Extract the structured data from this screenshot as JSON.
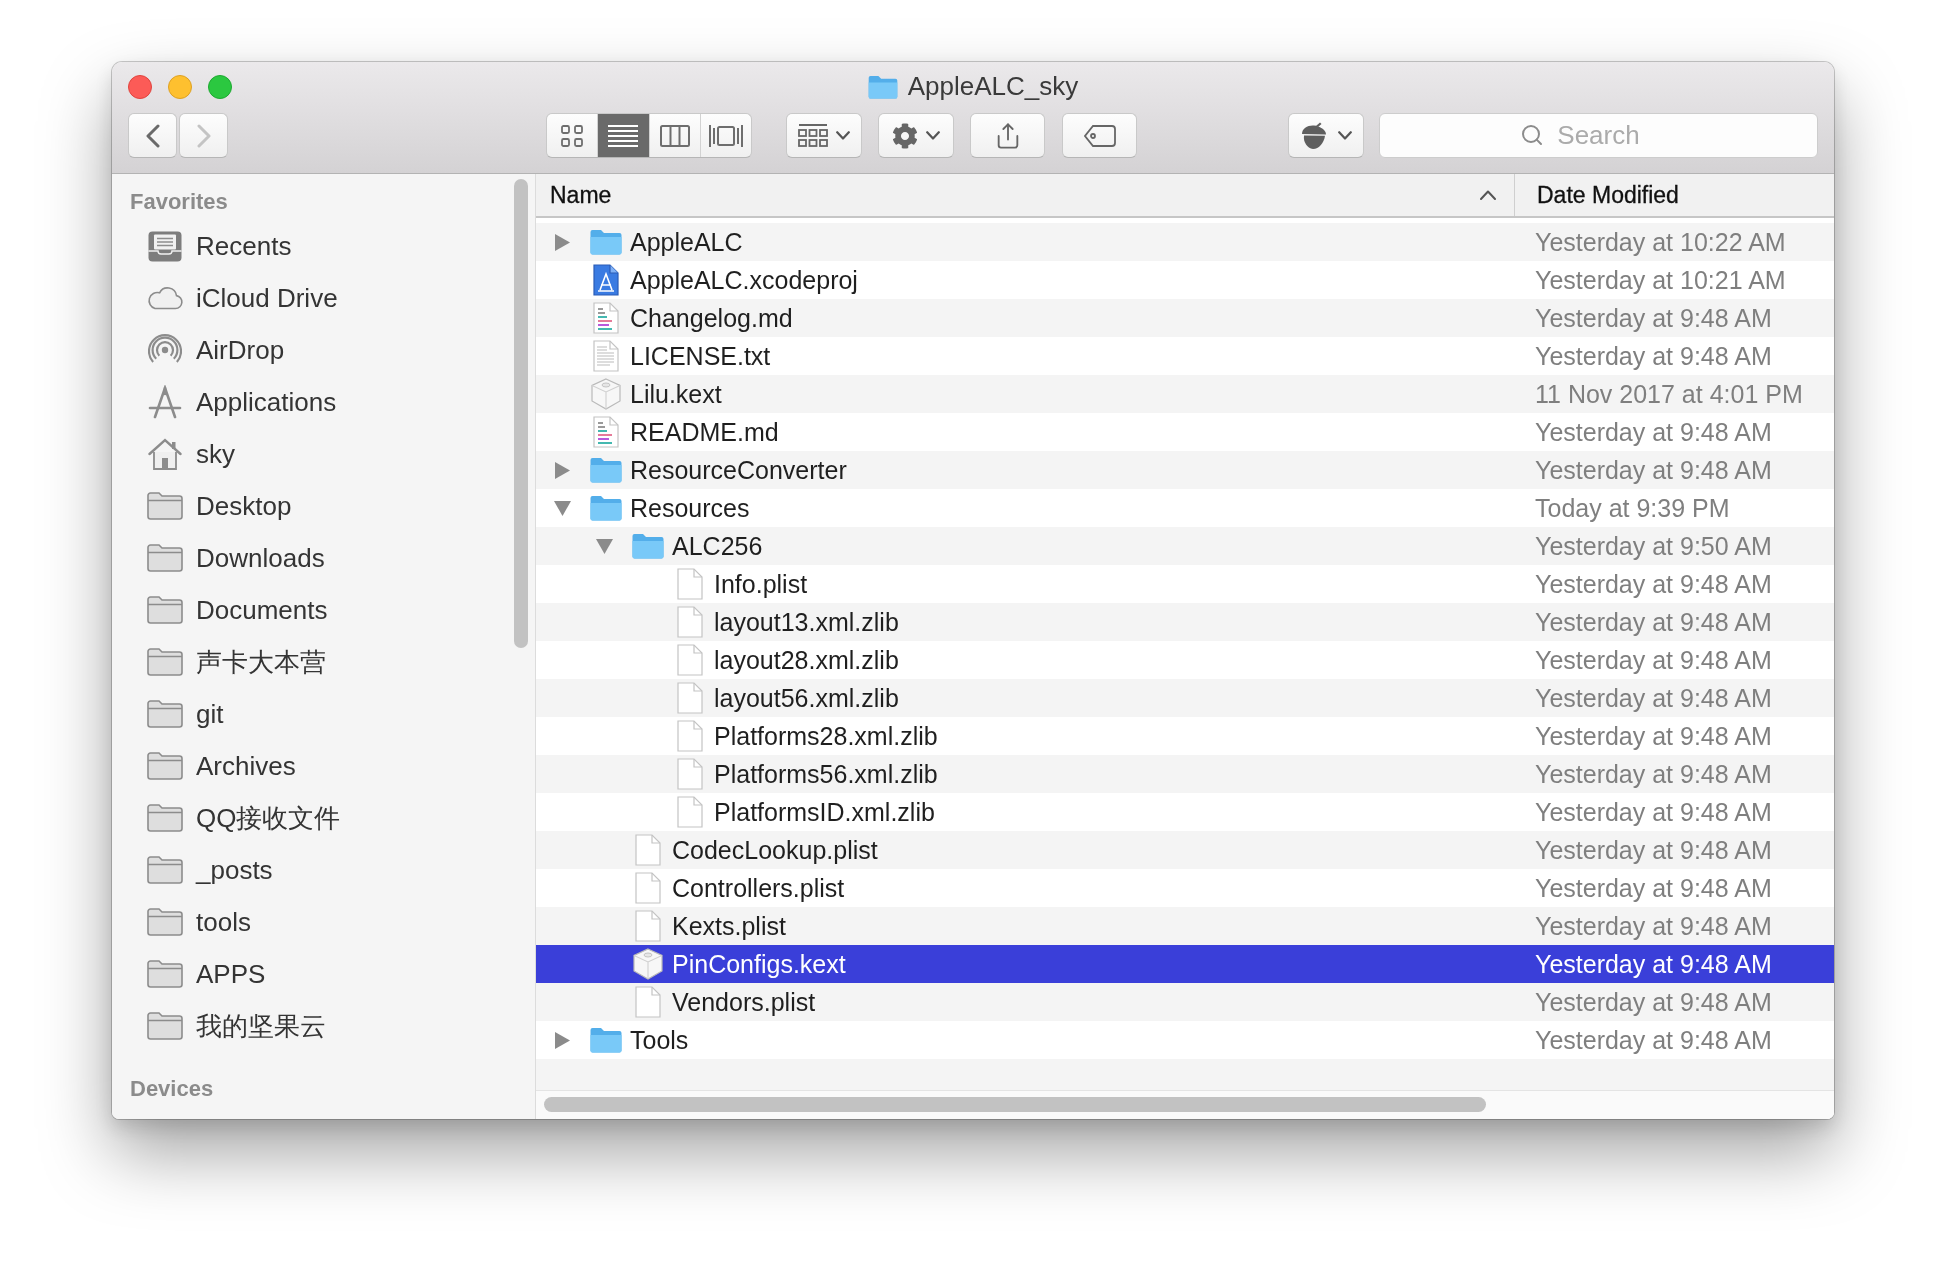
{
  "window": {
    "title": "AppleALC_sky"
  },
  "toolbar": {
    "navigation": [
      {
        "kind": "back",
        "disabled": false
      },
      {
        "kind": "forward",
        "disabled": true
      }
    ],
    "view_modes": [
      {
        "kind": "icons",
        "selected": false
      },
      {
        "kind": "list",
        "selected": true
      },
      {
        "kind": "columns",
        "selected": false
      },
      {
        "kind": "gallery",
        "selected": false
      }
    ],
    "search": {
      "placeholder": "Search"
    }
  },
  "sidebar": {
    "sections": [
      {
        "title": "Favorites",
        "items": [
          {
            "kind": "recents",
            "label": "Recents"
          },
          {
            "kind": "icloud",
            "label": "iCloud Drive"
          },
          {
            "kind": "airdrop",
            "label": "AirDrop"
          },
          {
            "kind": "applications",
            "label": "Applications"
          },
          {
            "kind": "home",
            "label": "sky"
          },
          {
            "kind": "folder",
            "label": "Desktop"
          },
          {
            "kind": "folder",
            "label": "Downloads"
          },
          {
            "kind": "folder",
            "label": "Documents"
          },
          {
            "kind": "folder",
            "label": "声卡大本营"
          },
          {
            "kind": "folder",
            "label": "git"
          },
          {
            "kind": "folder",
            "label": "Archives"
          },
          {
            "kind": "folder",
            "label": "QQ接收文件"
          },
          {
            "kind": "folder",
            "label": "_posts"
          },
          {
            "kind": "folder",
            "label": "tools"
          },
          {
            "kind": "folder",
            "label": "APPS"
          },
          {
            "kind": "folder",
            "label": "我的坚果云"
          }
        ]
      },
      {
        "title": "Devices"
      }
    ]
  },
  "file_list": {
    "columns": [
      {
        "label": "Name",
        "sorted": true
      },
      {
        "label": "Date Modified",
        "sorted": false
      }
    ],
    "rows": [
      {
        "name": "AppleALC",
        "kind": "folder",
        "expanded": false,
        "modified": "Yesterday at 10:22 AM",
        "selected": false
      },
      {
        "name": "AppleALC.xcodeproj",
        "kind": "xcodeproj",
        "modified": "Yesterday at 10:21 AM",
        "selected": false
      },
      {
        "name": "Changelog.md",
        "kind": "markdown",
        "modified": "Yesterday at 9:48 AM",
        "selected": false
      },
      {
        "name": "LICENSE.txt",
        "kind": "text",
        "modified": "Yesterday at 9:48 AM",
        "selected": false
      },
      {
        "name": "Lilu.kext",
        "kind": "kext",
        "modified": "11 Nov 2017 at 4:01 PM",
        "selected": false
      },
      {
        "name": "README.md",
        "kind": "markdown",
        "modified": "Yesterday at 9:48 AM",
        "selected": false
      },
      {
        "name": "ResourceConverter",
        "kind": "folder",
        "expanded": false,
        "modified": "Yesterday at 9:48 AM",
        "selected": false
      },
      {
        "name": "Resources",
        "kind": "folder",
        "expanded": true,
        "modified": "Today at 9:39 PM",
        "selected": false,
        "children": [
          {
            "name": "ALC256",
            "kind": "folder",
            "expanded": true,
            "modified": "Yesterday at 9:50 AM",
            "selected": false,
            "children": [
              {
                "name": "Info.plist",
                "kind": "document",
                "modified": "Yesterday at 9:48 AM",
                "selected": false
              },
              {
                "name": "layout13.xml.zlib",
                "kind": "document",
                "modified": "Yesterday at 9:48 AM",
                "selected": false
              },
              {
                "name": "layout28.xml.zlib",
                "kind": "document",
                "modified": "Yesterday at 9:48 AM",
                "selected": false
              },
              {
                "name": "layout56.xml.zlib",
                "kind": "document",
                "modified": "Yesterday at 9:48 AM",
                "selected": false
              },
              {
                "name": "Platforms28.xml.zlib",
                "kind": "document",
                "modified": "Yesterday at 9:48 AM",
                "selected": false
              },
              {
                "name": "Platforms56.xml.zlib",
                "kind": "document",
                "modified": "Yesterday at 9:48 AM",
                "selected": false
              },
              {
                "name": "PlatformsID.xml.zlib",
                "kind": "document",
                "modified": "Yesterday at 9:48 AM",
                "selected": false
              }
            ]
          },
          {
            "name": "CodecLookup.plist",
            "kind": "document",
            "modified": "Yesterday at 9:48 AM",
            "selected": false
          },
          {
            "name": "Controllers.plist",
            "kind": "document",
            "modified": "Yesterday at 9:48 AM",
            "selected": false
          },
          {
            "name": "Kexts.plist",
            "kind": "document",
            "modified": "Yesterday at 9:48 AM",
            "selected": false
          },
          {
            "name": "PinConfigs.kext",
            "kind": "kext",
            "modified": "Yesterday at 9:48 AM",
            "selected": true
          },
          {
            "name": "Vendors.plist",
            "kind": "document",
            "modified": "Yesterday at 9:48 AM",
            "selected": false
          }
        ]
      },
      {
        "name": "Tools",
        "kind": "folder",
        "expanded": false,
        "modified": "Yesterday at 9:48 AM",
        "selected": false
      }
    ]
  }
}
